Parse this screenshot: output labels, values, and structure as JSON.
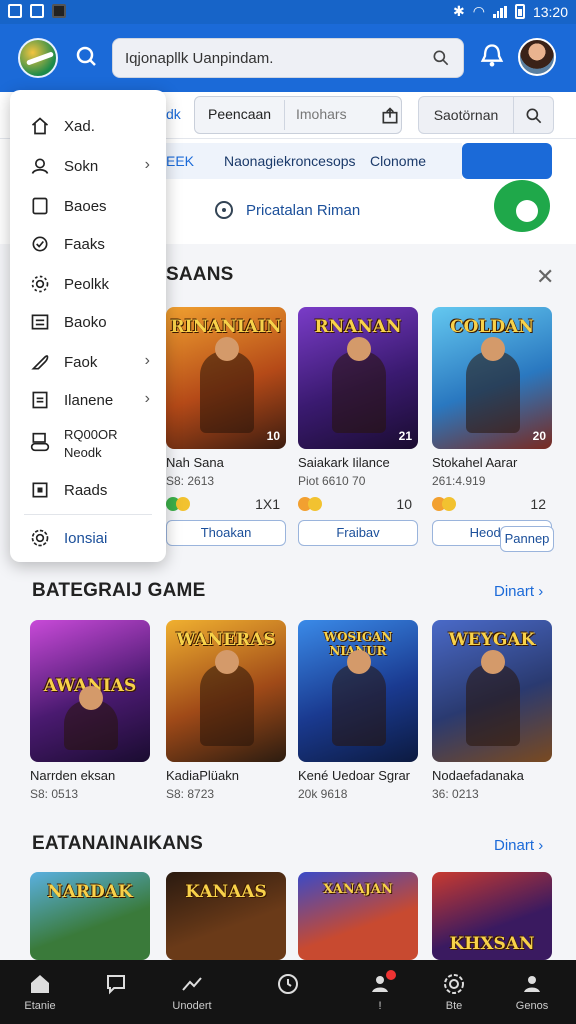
{
  "status_bar": {
    "time": "13:20"
  },
  "header": {
    "search_value": "Iqjonapllk Uanpindam."
  },
  "tabs": {
    "active": "dk",
    "items": [
      "Peencaan",
      "Imohars"
    ],
    "sort_label": "Saotörnan"
  },
  "subfilters": {
    "items": [
      "EEK",
      "Naonagiekroncesops",
      "Clonome"
    ]
  },
  "promo": {
    "text": "Pricatalan Riman"
  },
  "menu": {
    "items": [
      {
        "label": "Xad.",
        "icon": "home-icon"
      },
      {
        "label": "Sokn",
        "icon": "user-icon",
        "chevron": true
      },
      {
        "label": "Baoes",
        "icon": "bookmark-icon"
      },
      {
        "label": "Faaks",
        "icon": "badge-icon"
      },
      {
        "label": "Peolkk",
        "icon": "gear-icon"
      },
      {
        "label": "Baoko",
        "icon": "list-icon"
      },
      {
        "label": "Faok",
        "icon": "feather-icon",
        "chevron": true
      },
      {
        "label": "Ilanene",
        "icon": "document-icon",
        "chevron": true
      },
      {
        "label": "RQ00OR\nNeodk",
        "icon": "gamepad-icon"
      },
      {
        "label": "Raads",
        "icon": "square-icon"
      },
      {
        "label": "Ionsiai",
        "icon": "settings-icon"
      }
    ]
  },
  "section1": {
    "title": "SAANS",
    "cards": [
      {
        "art": "RINANIAIN",
        "name": "Nah Sana",
        "meta": "S8: 2613",
        "count": "1X1",
        "button": "Thoakan",
        "badge": "10"
      },
      {
        "art": "RNANAN",
        "name": "Saiakark Iilance",
        "meta": "Piot 6610 70",
        "count": "10",
        "button": "Fraibav",
        "badge": "21"
      },
      {
        "art": "COLDAN",
        "name": "Stokahel Aarar",
        "meta": "261:4.919",
        "count": "12",
        "button": "Heodav",
        "badge": "20"
      }
    ],
    "extra_button": "Pannep"
  },
  "section2": {
    "title": "BATEGRAIJ GAME",
    "see_all": "Dinart",
    "cards": [
      {
        "art": "AWANIAS",
        "name": "Narrden eksan",
        "meta": "S8: 0513"
      },
      {
        "art": "WANERAS",
        "name": "KadiaPlüakn",
        "meta": "S8: 8723"
      },
      {
        "art": "WOSIGAN NIANUR",
        "name": "Kené Uedoar Sgrar",
        "meta": "20k 9618"
      },
      {
        "art": "WEYGAK",
        "name": "Nodaefadanaka",
        "meta": "36: 0213"
      }
    ]
  },
  "section3": {
    "title": "EATANAINAIKANS",
    "see_all": "Dinart",
    "cards": [
      {
        "art": "NARDAK"
      },
      {
        "art": "KANAAS"
      },
      {
        "art": "XANAJAN"
      },
      {
        "art": "KHXSAN"
      }
    ]
  },
  "bottom_nav": {
    "items": [
      {
        "label": "Etanie",
        "icon": "home-icon"
      },
      {
        "label": "",
        "icon": "chat-icon"
      },
      {
        "label": "Unodert",
        "icon": "trending-icon"
      },
      {
        "label": "",
        "icon": "clock-icon"
      },
      {
        "label": "!",
        "icon": "user-notif-icon"
      },
      {
        "label": "Bte",
        "icon": "gear-icon"
      },
      {
        "label": "Genos",
        "icon": "profile-icon"
      }
    ]
  },
  "colors": {
    "primary": "#1b6ad8",
    "accent_green": "#1fa84a",
    "bottom_bg": "#141414"
  }
}
